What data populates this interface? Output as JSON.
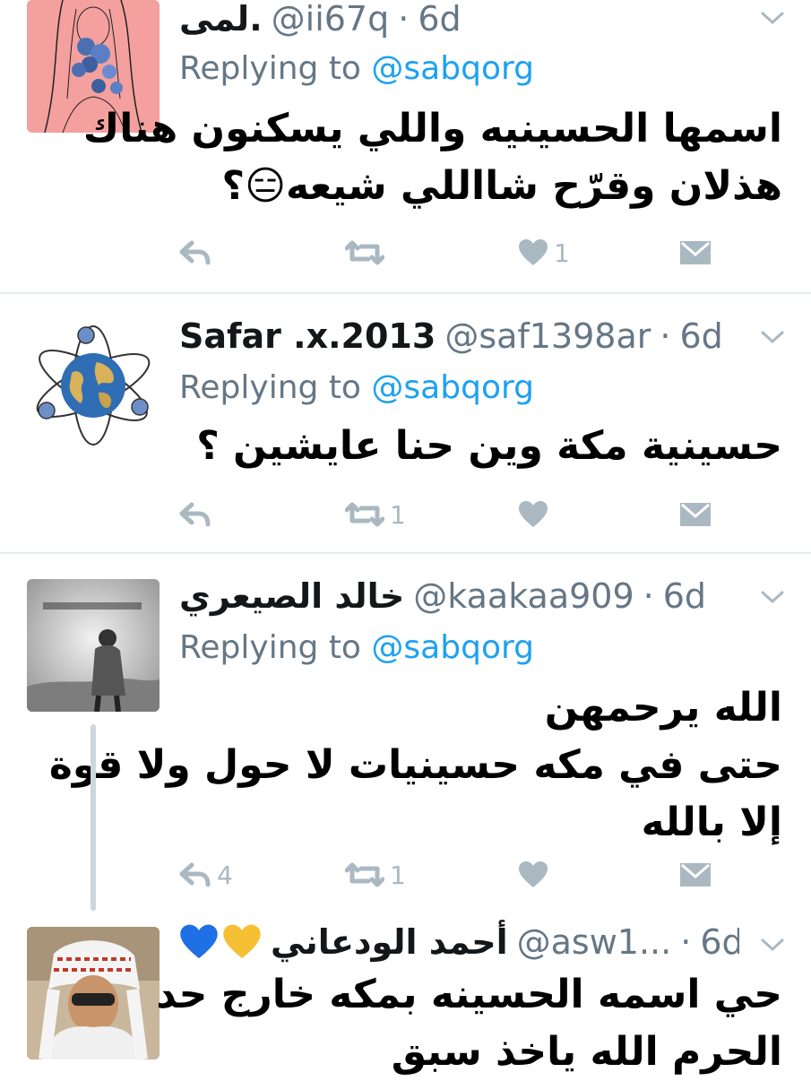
{
  "tweets": [
    {
      "name": "لمى.",
      "handle": "@ii67q",
      "dot": "·",
      "time": "6d",
      "reply_prefix": "Replying to",
      "reply_mention": "@sabqorg",
      "text_lines": [
        "اسمها الحسينيه واللي يسكنون هناك",
        "هذلان وقرّح شااللي شيعه😑؟"
      ],
      "reply_count": "",
      "retweet_count": "",
      "like_count": "1"
    },
    {
      "name": "Safar .x.2013",
      "handle": "@saf1398ar",
      "dot": "·",
      "time": "6d",
      "reply_prefix": "Replying to",
      "reply_mention": "@sabqorg",
      "text_lines": [
        "حسينية مكة وين حنا عايشين ؟"
      ],
      "reply_count": "",
      "retweet_count": "1",
      "like_count": ""
    },
    {
      "name": "خالد الصيعري",
      "handle": "@kaakaa909",
      "dot": "·",
      "time": "6d",
      "reply_prefix": "Replying to",
      "reply_mention": "@sabqorg",
      "text_lines": [
        "الله يرحمهن",
        "حتى في مكه حسينيات لا حول ولا قوة",
        "إلا بالله"
      ],
      "reply_count": "4",
      "retweet_count": "1",
      "like_count": ""
    },
    {
      "name": "أحمد الودعاني",
      "emojis": "💛💙",
      "handle": "@asw1...",
      "dot": "·",
      "time": "6d",
      "text_lines": [
        "حي اسمه الحسينه بمكه خارج حد",
        "الحرم الله ياخذ سبق"
      ]
    }
  ],
  "colors": {
    "name": "#14171a",
    "meta": "#657786",
    "mention": "#1da1f2",
    "icon": "#aab8c2",
    "divider": "#e6ecf0"
  }
}
